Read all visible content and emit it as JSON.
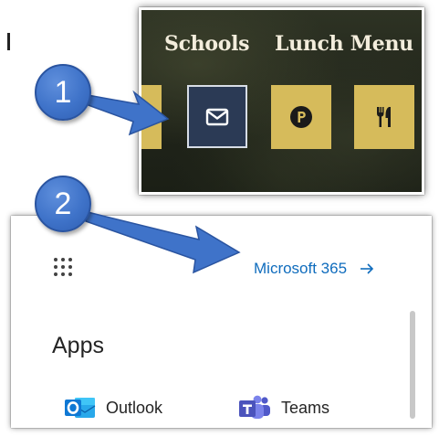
{
  "panel_website": {
    "nav_items": [
      {
        "label": "Schools"
      },
      {
        "label": "Lunch Menu"
      }
    ],
    "icons": [
      "mail-icon",
      "parking-icon",
      "dining-icon"
    ],
    "colors": {
      "gold": "#d6bb5b",
      "mail_tile": "#2b3a55",
      "nav_text": "#f3eddc"
    }
  },
  "panel_launcher": {
    "link_label": "Microsoft 365",
    "apps_heading": "Apps",
    "apps": [
      {
        "label": "Outlook",
        "icon": "outlook-icon"
      },
      {
        "label": "Teams",
        "icon": "teams-icon"
      }
    ],
    "colors": {
      "link": "#0f6cbd",
      "outlook": "#0f78d4",
      "teams": "#5059c9"
    }
  },
  "callouts": [
    {
      "number": "1"
    },
    {
      "number": "2"
    }
  ],
  "colors": {
    "callout_fill": "#3f73c9"
  }
}
